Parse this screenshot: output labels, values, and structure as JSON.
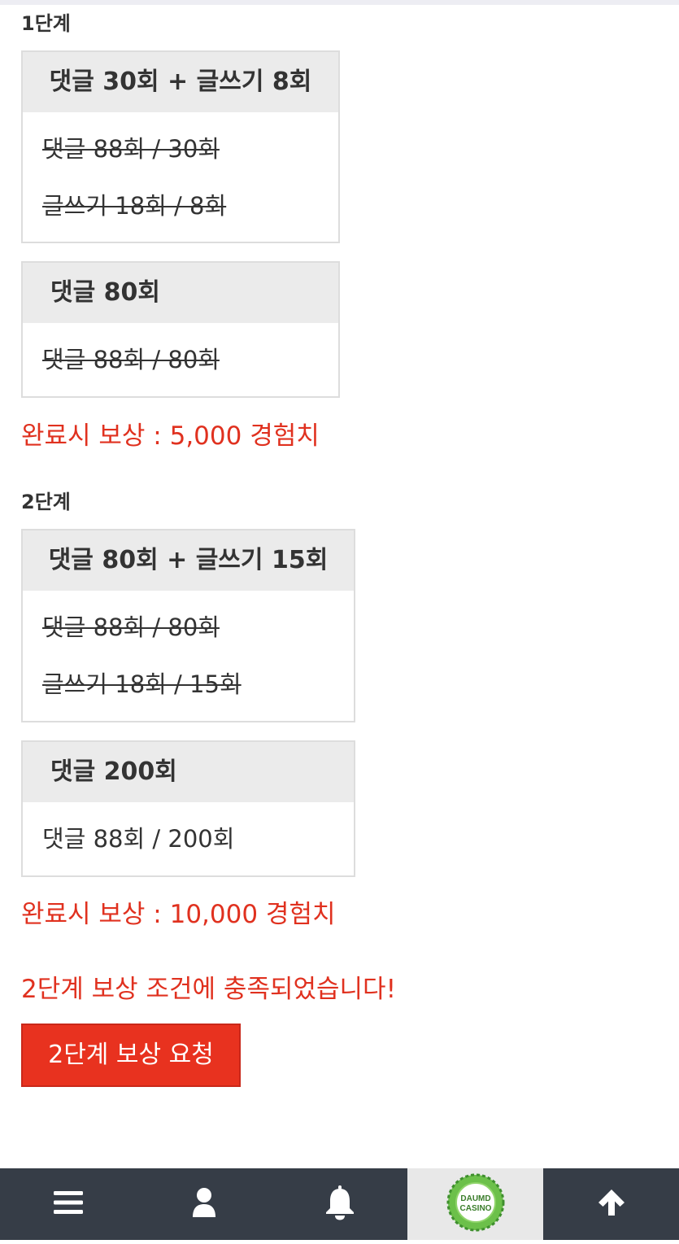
{
  "stages": [
    {
      "title": "1단계",
      "boxes": [
        {
          "header": "댓글 30회 + 글쓰기 8회",
          "rows": [
            "댓글 88회 / 30회",
            "글쓰기 18회 / 8회"
          ]
        },
        {
          "header": "댓글 80회",
          "rows": [
            "댓글 88회 / 80회"
          ]
        }
      ],
      "reward": "완료시 보상 : 5,000 경험치"
    },
    {
      "title": "2단계",
      "boxes": [
        {
          "header": "댓글 80회 + 글쓰기 15회",
          "rows": [
            "댓글 88회 / 80회",
            "글쓰기 18회 / 15회"
          ]
        },
        {
          "header": "댓글 200회",
          "rows": [
            "댓글 88회 / 200회"
          ]
        }
      ],
      "reward": "완료시 보상 : 10,000 경험치"
    }
  ],
  "notice": "2단계 보상 조건에 충족되었습니다!",
  "request_button": "2단계 보상 요청",
  "bottom_nav": {
    "icons": [
      "menu-icon",
      "user-icon",
      "bell-icon",
      "logo",
      "arrow-up-icon"
    ],
    "logo_text": [
      "DAUMD",
      "CASINO"
    ]
  },
  "colors": {
    "accent_red": "#e0311f",
    "button_red": "#e8321f",
    "nav_bg": "#363d47"
  }
}
